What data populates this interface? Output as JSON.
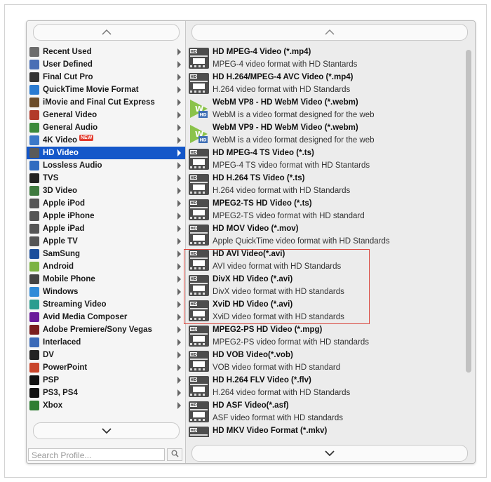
{
  "left_panel": {
    "items": [
      {
        "label": "Recent Used",
        "icon": "recent-icon",
        "color": "#6d6d6d"
      },
      {
        "label": "User Defined",
        "icon": "user-icon",
        "color": "#4a6fb5"
      },
      {
        "label": "Final Cut Pro",
        "icon": "final-cut-icon",
        "color": "#333333"
      },
      {
        "label": "QuickTime Movie Format",
        "icon": "quicktime-icon",
        "color": "#2a7bd1"
      },
      {
        "label": "iMovie and Final Cut Express",
        "icon": "imovie-icon",
        "color": "#6b4d2a"
      },
      {
        "label": "General Video",
        "icon": "film-icon",
        "color": "#b23a2a"
      },
      {
        "label": "General Audio",
        "icon": "music-icon",
        "color": "#3c8a3c"
      },
      {
        "label": "4K Video",
        "icon": "4k-icon",
        "color": "#3b78c8",
        "badge": "NEW"
      },
      {
        "label": "HD Video",
        "icon": "hd-icon",
        "color": "#5a5a5a",
        "selected": true
      },
      {
        "label": "Lossless Audio",
        "icon": "lossless-audio-icon",
        "color": "#2f6bc0"
      },
      {
        "label": "TVS",
        "icon": "tv-icon",
        "color": "#222222"
      },
      {
        "label": "3D Video",
        "icon": "3d-icon",
        "color": "#3f7a3f"
      },
      {
        "label": "Apple iPod",
        "icon": "apple-icon",
        "color": "#555555"
      },
      {
        "label": "Apple iPhone",
        "icon": "apple-icon",
        "color": "#555555"
      },
      {
        "label": "Apple iPad",
        "icon": "apple-icon",
        "color": "#555555"
      },
      {
        "label": "Apple TV",
        "icon": "apple-icon",
        "color": "#555555"
      },
      {
        "label": "SamSung",
        "icon": "samsung-icon",
        "color": "#1c4f9c"
      },
      {
        "label": "Android",
        "icon": "android-icon",
        "color": "#7cb342"
      },
      {
        "label": "Mobile Phone",
        "icon": "phone-icon",
        "color": "#444444"
      },
      {
        "label": "Windows",
        "icon": "windows-icon",
        "color": "#2f8bd8"
      },
      {
        "label": "Streaming Video",
        "icon": "streaming-icon",
        "color": "#2a9d8f"
      },
      {
        "label": "Avid Media Composer",
        "icon": "avid-icon",
        "color": "#6a1b9a"
      },
      {
        "label": "Adobe Premiere/Sony Vegas",
        "icon": "adobe-icon",
        "color": "#7a1e1e"
      },
      {
        "label": "Interlaced",
        "icon": "interlaced-icon",
        "color": "#3b6ab8"
      },
      {
        "label": "DV",
        "icon": "dv-icon",
        "color": "#222222"
      },
      {
        "label": "PowerPoint",
        "icon": "powerpoint-icon",
        "color": "#c9452b"
      },
      {
        "label": "PSP",
        "icon": "psp-icon",
        "color": "#111111"
      },
      {
        "label": "PS3, PS4",
        "icon": "ps-icon",
        "color": "#111111"
      },
      {
        "label": "Xbox",
        "icon": "xbox-icon",
        "color": "#2e7d32"
      }
    ],
    "search_placeholder": "Search Profile..."
  },
  "right_panel": {
    "formats": [
      {
        "title": "HD MPEG-4 Video (*.mp4)",
        "desc": "MPEG-4 video format with HD Stantards",
        "icon": "hd-film-icon"
      },
      {
        "title": "HD H.264/MPEG-4 AVC Video (*.mp4)",
        "desc": "H.264 video format with HD Standards",
        "icon": "hd-film-icon"
      },
      {
        "title": "WebM VP8 - HD WebM Video (*.webm)",
        "desc": "WebM is a video format designed for the web",
        "icon": "webm-icon"
      },
      {
        "title": "WebM VP9 - HD WebM Video (*.webm)",
        "desc": "WebM is a video format designed for the web",
        "icon": "webm-icon"
      },
      {
        "title": "HD MPEG-4 TS Video (*.ts)",
        "desc": "MPEG-4 TS video format with HD Stantards",
        "icon": "hd-film-icon"
      },
      {
        "title": "HD H.264 TS Video (*.ts)",
        "desc": "H.264 video format with HD Standards",
        "icon": "hd-film-icon"
      },
      {
        "title": "MPEG2-TS HD Video (*.ts)",
        "desc": "MPEG2-TS video format with HD standard",
        "icon": "hd-film-icon"
      },
      {
        "title": "HD MOV Video (*.mov)",
        "desc": "Apple QuickTime video format with HD Standards",
        "icon": "hd-film-icon"
      },
      {
        "title": "HD AVI Video(*.avi)",
        "desc": "AVI video format with HD Standards",
        "icon": "hd-film-icon"
      },
      {
        "title": "DivX HD Video (*.avi)",
        "desc": "DivX video format with HD standards",
        "icon": "hd-film-icon"
      },
      {
        "title": "XviD HD Video (*.avi)",
        "desc": "XviD video format with HD standards",
        "icon": "hd-film-icon"
      },
      {
        "title": "MPEG2-PS HD Video (*.mpg)",
        "desc": "MPEG2-PS video format with HD standards",
        "icon": "hd-film-icon"
      },
      {
        "title": "HD VOB Video(*.vob)",
        "desc": "VOB video format with HD standard",
        "icon": "hd-film-icon"
      },
      {
        "title": "HD H.264 FLV Video (*.flv)",
        "desc": "H.264 video format with HD Standards",
        "icon": "hd-film-icon"
      },
      {
        "title": "HD ASF Video(*.asf)",
        "desc": "ASF video format with HD standards",
        "icon": "hd-film-icon"
      },
      {
        "title": "HD MKV Video Format (*.mkv)",
        "desc": "",
        "icon": "hd-film-icon"
      }
    ]
  },
  "colors": {
    "selection": "#1457c9",
    "highlight_border": "#d9463d",
    "webm_green": "#8bc34a",
    "hd_icon": "#4d4d4d"
  }
}
